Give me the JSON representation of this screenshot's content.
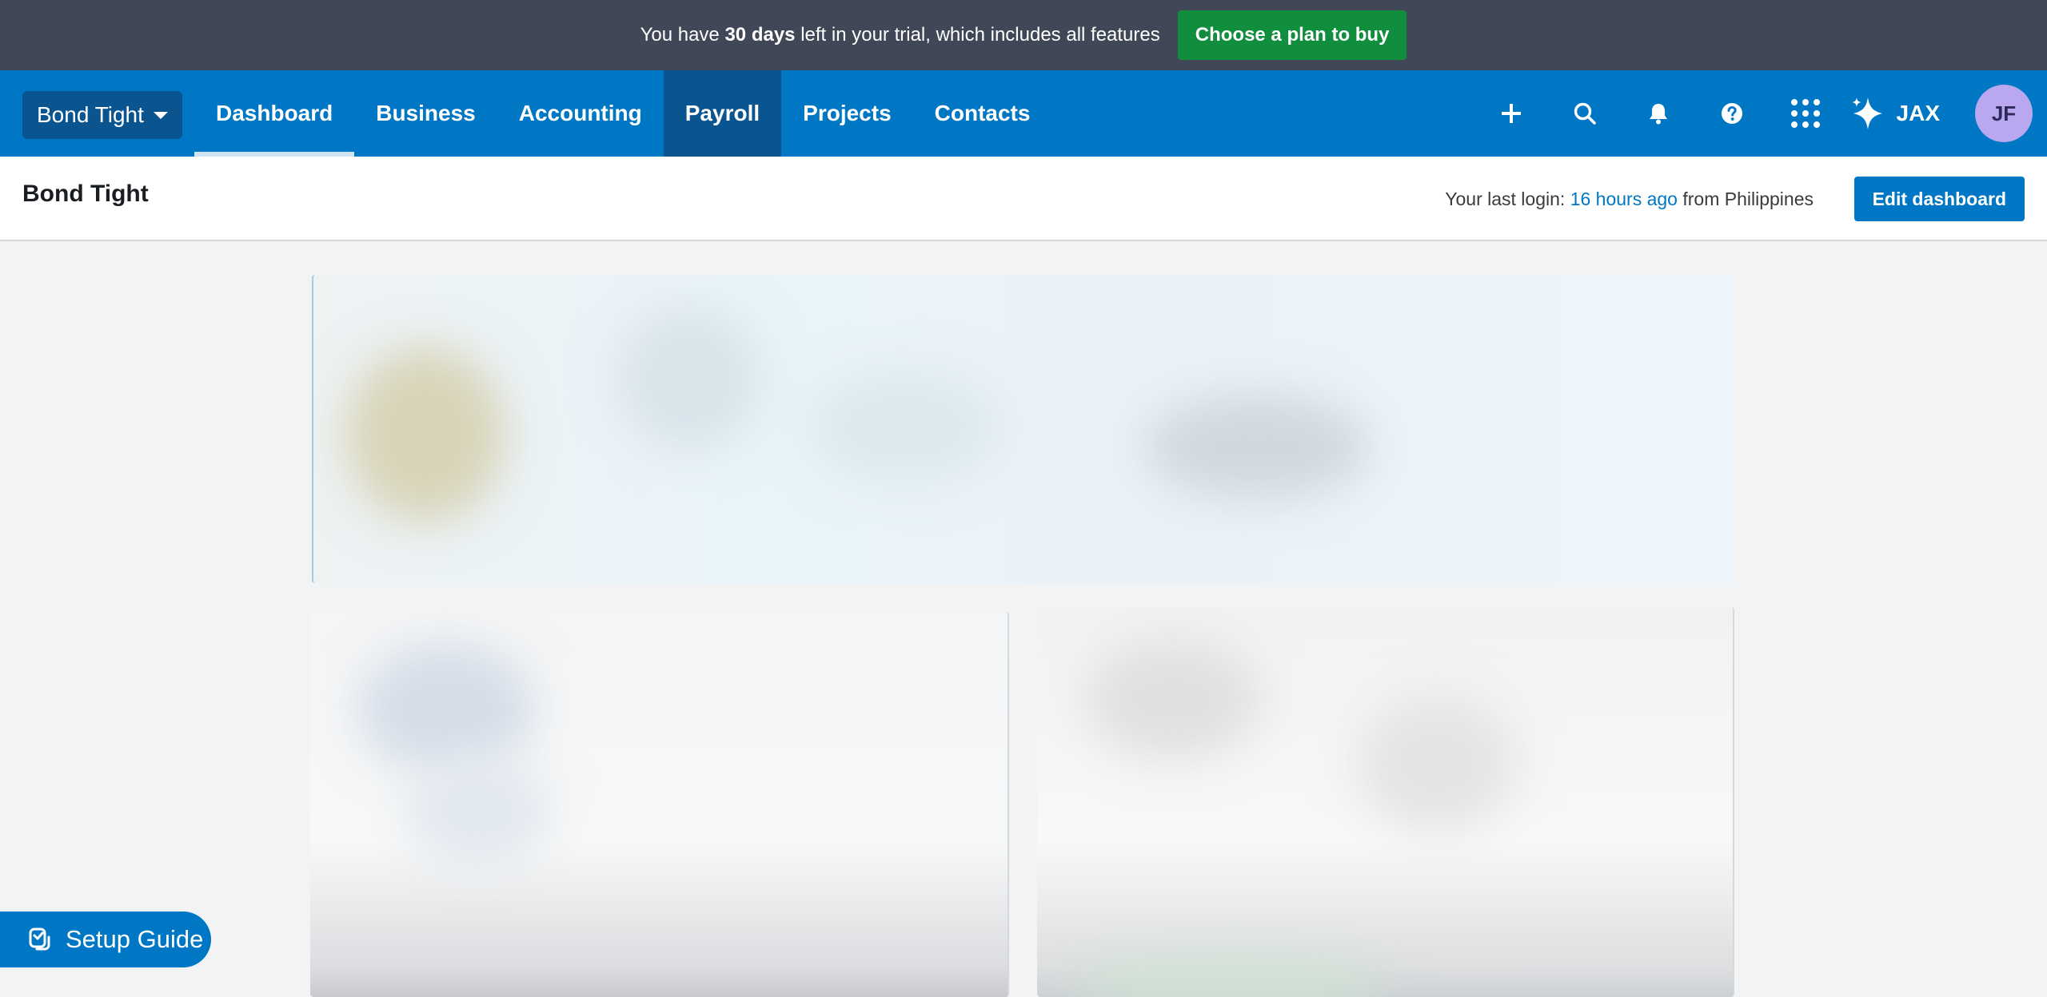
{
  "trial": {
    "prefix": "You have ",
    "days": "30 days",
    "suffix": " left in your trial, which includes all features",
    "cta": "Choose a plan to buy"
  },
  "nav": {
    "company": "Bond Tight",
    "tabs": [
      {
        "label": "Dashboard"
      },
      {
        "label": "Business"
      },
      {
        "label": "Accounting"
      },
      {
        "label": "Payroll"
      },
      {
        "label": "Projects"
      },
      {
        "label": "Contacts"
      }
    ],
    "icons": [
      "plus-icon",
      "search-icon",
      "bell-icon",
      "help-icon",
      "app-grid-icon"
    ],
    "jax_label": "JAX",
    "avatar_initials": "JF"
  },
  "header": {
    "title": "Bond Tight",
    "last_login_prefix": "Your last login: ",
    "last_login_time": "16 hours ago",
    "last_login_suffix": " from Philippines",
    "edit_button": "Edit dashboard"
  },
  "setup_guide": {
    "label": "Setup Guide"
  },
  "colors": {
    "trial_bg": "#404756",
    "cta_green": "#108d3d",
    "nav_blue": "#0077c5",
    "nav_dark": "#0a5490",
    "avatar_bg": "#b9a8f0"
  }
}
